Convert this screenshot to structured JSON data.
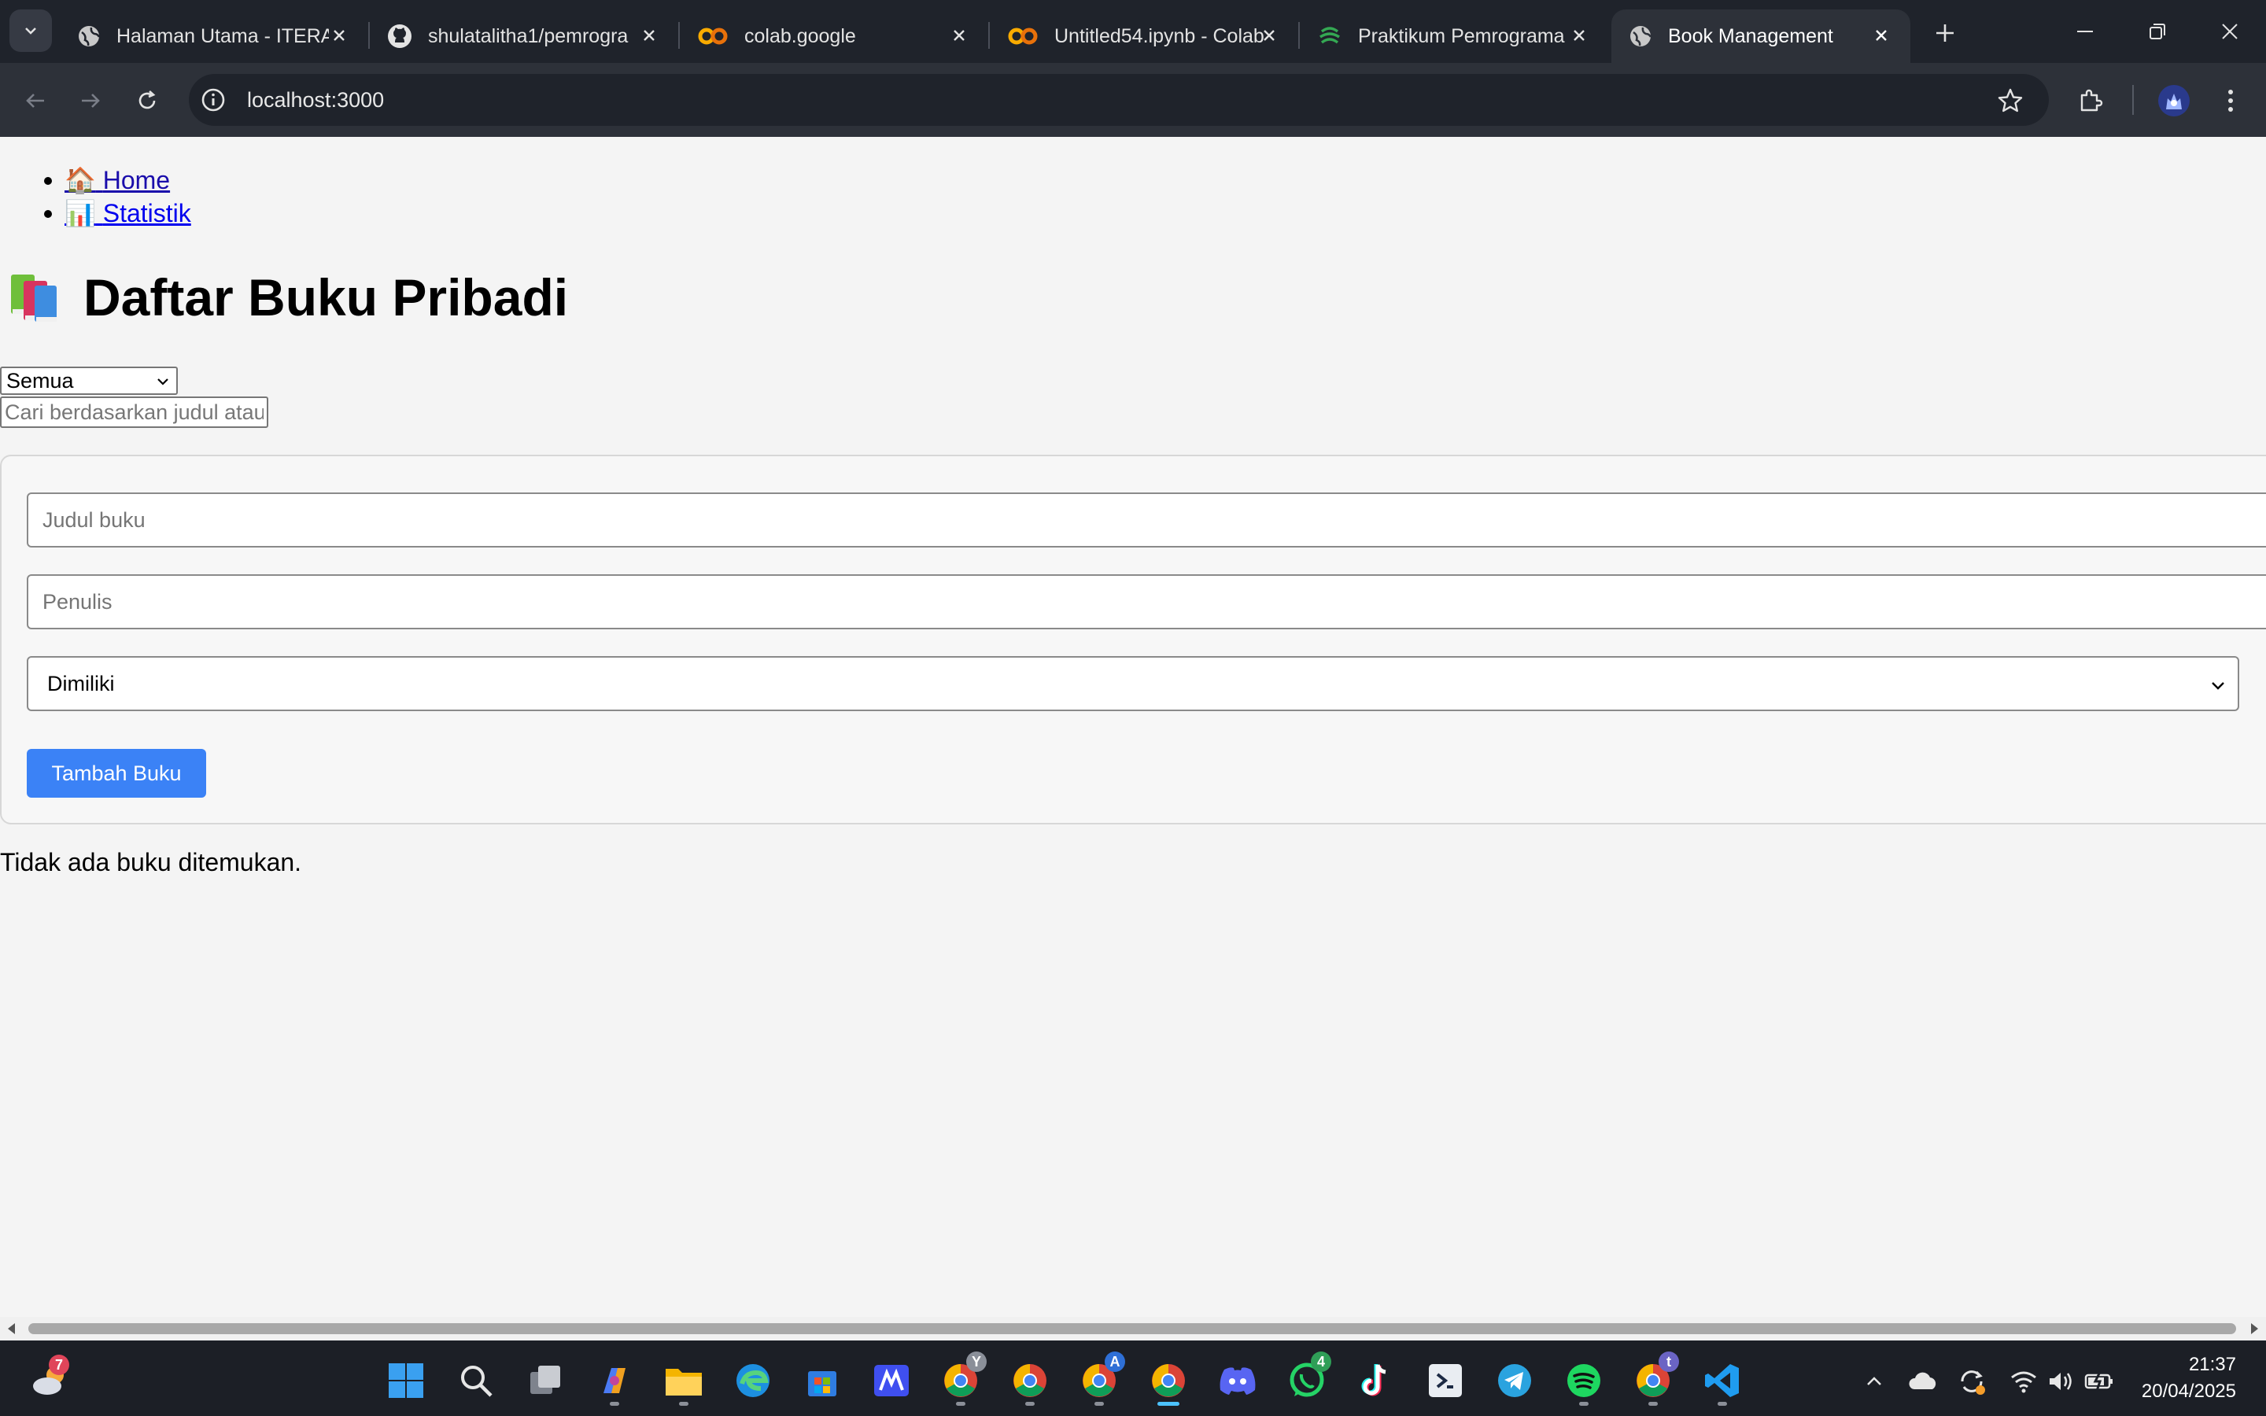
{
  "browser": {
    "tabs": [
      {
        "title": "Halaman Utama - ITERA",
        "icon": "globe-icon"
      },
      {
        "title": "shulatalitha1/pemrogra",
        "icon": "github-icon"
      },
      {
        "title": "colab.google",
        "icon": "colab-icon"
      },
      {
        "title": "Untitled54.ipynb - Colab",
        "icon": "colab-icon"
      },
      {
        "title": "Praktikum Pemrograma",
        "icon": "spiral-icon"
      },
      {
        "title": "Book Management",
        "icon": "globe-icon",
        "active": true
      }
    ],
    "url": "localhost:3000"
  },
  "nav": {
    "home_icon": "🏠",
    "home_label": "Home",
    "stats_icon": "📊",
    "stats_label": "Statistik"
  },
  "page": {
    "title_icon": "books-icon",
    "title": "Daftar Buku Pribadi"
  },
  "filter": {
    "selected": "Semua",
    "search_placeholder": "Cari berdasarkan judul atau penulis"
  },
  "form": {
    "title_placeholder": "Judul buku",
    "author_placeholder": "Penulis",
    "status_selected": "Dimiliki",
    "submit_label": "Tambah Buku"
  },
  "list": {
    "empty_message": "Tidak ada buku ditemukan."
  },
  "taskbar": {
    "weather_badge": "7",
    "whatsapp_badge": "4",
    "time": "21:37",
    "date": "20/04/2025"
  },
  "colors": {
    "accent": "#3b82f6",
    "tabbar": "#1f232b",
    "toolbar": "#2d3139",
    "page_bg": "#f4f4f4"
  }
}
